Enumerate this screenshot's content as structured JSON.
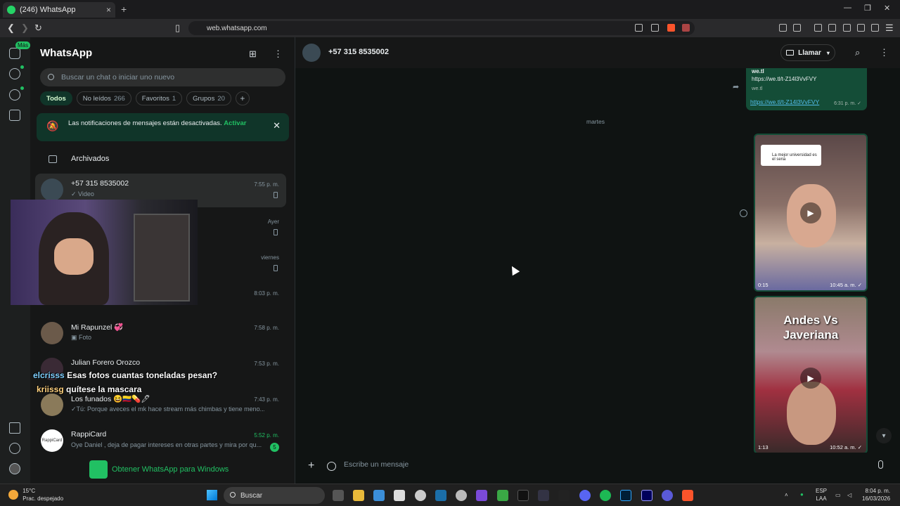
{
  "browser": {
    "tab_title": "(246) WhatsApp",
    "tab_close": "×",
    "new_tab": "+",
    "url": "web.whatsapp.com"
  },
  "rail": {
    "more_badge": "Más"
  },
  "sidebar": {
    "title": "WhatsApp",
    "search_placeholder": "Buscar un chat o iniciar uno nuevo",
    "filters": [
      {
        "label": "Todos",
        "count": ""
      },
      {
        "label": "No leídos",
        "count": "266"
      },
      {
        "label": "Favoritos",
        "count": "1"
      },
      {
        "label": "Grupos",
        "count": "20"
      }
    ],
    "add_filter": "+",
    "notification": {
      "text": "Las notificaciones de mensajes están desactivadas.",
      "action": "Activar",
      "close": "✕"
    },
    "archived_label": "Archivados",
    "chats": [
      {
        "name": "+57 315 8535002",
        "preview": "✓ Video",
        "time": "7:55 p. m."
      },
      {
        "name": "",
        "preview": "",
        "time": "Ayer"
      },
      {
        "name": "",
        "preview": "",
        "time": "viernes"
      },
      {
        "name": "",
        "preview": "",
        "time": "8:03 p. m."
      },
      {
        "name": "Mi Rapunzel 💞",
        "preview": "Foto",
        "time": "7:58 p. m."
      },
      {
        "name": "Julian Forero Orozco",
        "preview": "",
        "time": "7:53 p. m."
      },
      {
        "name": "Los funados 😆🇨🇴💊🖊",
        "preview": "✓Tú: Porque aveces el mk hace stream más chimbas y tiene meno...",
        "time": "7:43 p. m."
      },
      {
        "name": "RappiCard",
        "preview": "Oye Daniel , deja de pagar intereses en otras partes y mira por qu...",
        "time": "5:52 p. m.",
        "badge": "5",
        "avatar_text": "RappiCard"
      }
    ],
    "get_windows": "Obtener WhatsApp para Windows"
  },
  "stream_chat": [
    {
      "user": "elcrisss",
      "message": "Esas fotos cuantas toneladas pesan?"
    },
    {
      "user": "kriissg",
      "message": "quítese la mascara"
    }
  ],
  "conversation": {
    "contact": "+57 315 8535002",
    "call_label": "Llamar",
    "date_separator": "martes",
    "link_message": {
      "title": "we.tl",
      "link_preview_url": "https://we.tl/t-Z14l3VvFVY",
      "domain": "we.tl",
      "link": "https://we.tl/t-Z14l3VvFVY",
      "time": "6:31 p. m. ✓"
    },
    "video1": {
      "caption": "La mejor universidad es el sena",
      "duration": "0:15",
      "time": "10:45 a. m. ✓"
    },
    "video2": {
      "title": "Andes Vs Javeriana",
      "duration": "1:13",
      "time": "10:52 a. m. ✓"
    },
    "composer_placeholder": "Escribe un mensaje"
  },
  "taskbar": {
    "temperature": "15°C",
    "weather": "Prac. despejado",
    "search": "Buscar",
    "lang": "ESP",
    "lang2": "LAA",
    "time": "8:04 p. m.",
    "date": "16/03/2026"
  },
  "colors": {
    "accent": "#21c063",
    "bubble_out": "#144d37",
    "link": "#53bdeb"
  }
}
